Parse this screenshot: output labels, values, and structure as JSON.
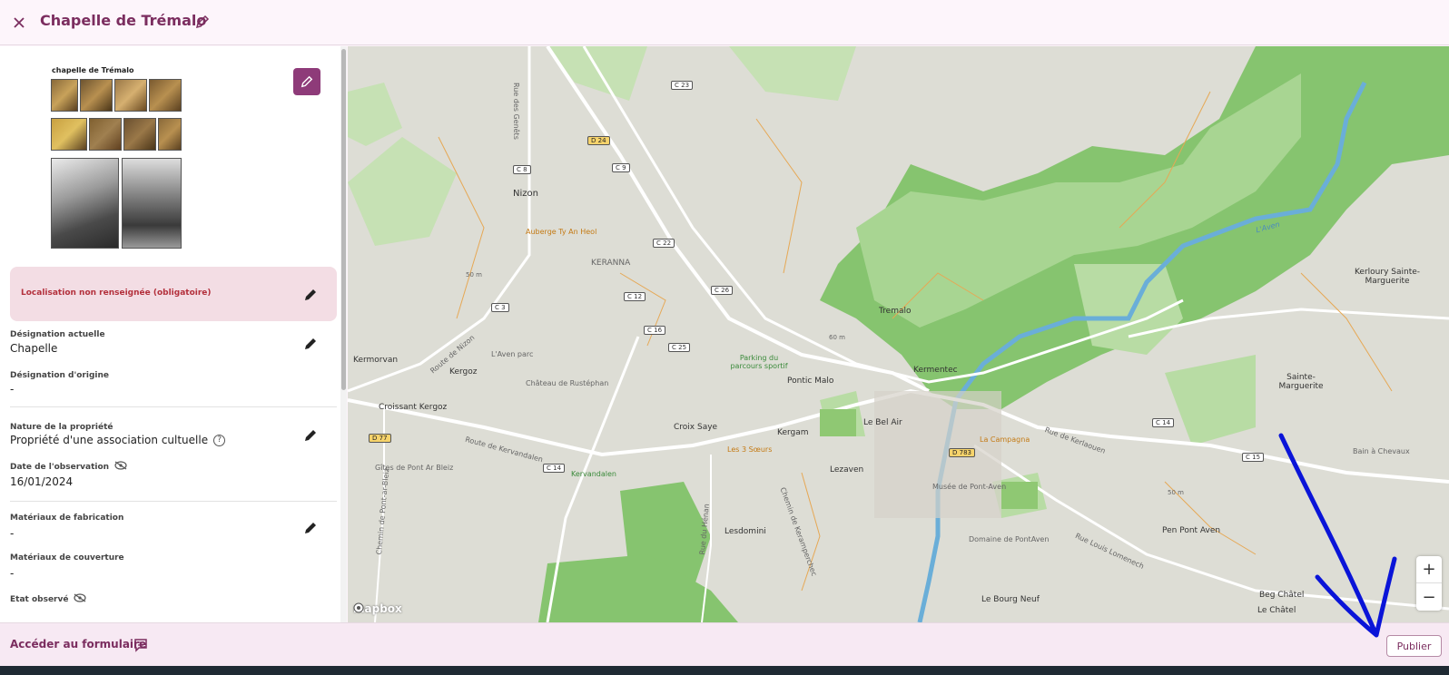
{
  "header": {
    "title": "Chapelle de Trémalo"
  },
  "photo": {
    "caption": "chapelle de Trémalo"
  },
  "alert": {
    "text": "Localisation non renseignée (obligatoire)"
  },
  "fields": {
    "designation_actuelle_label": "Désignation actuelle",
    "designation_actuelle_value": "Chapelle",
    "designation_origine_label": "Désignation d'origine",
    "designation_origine_value": "-",
    "nature_propriete_label": "Nature de la propriété",
    "nature_propriete_value": "Propriété d'une association cultuelle",
    "date_observation_label": "Date de l'observation",
    "date_observation_value": "16/01/2024",
    "materiaux_fabrication_label": "Matériaux de fabrication",
    "materiaux_fabrication_value": "-",
    "materiaux_couverture_label": "Matériaux de couverture",
    "materiaux_couverture_value": "-",
    "etat_observe_label": "Etat observé"
  },
  "map": {
    "attribution": "mapbox",
    "zoom_in": "+",
    "zoom_out": "−",
    "places": [
      "Nizon",
      "KERANNA",
      "Kermorvan",
      "Kergoz",
      "Croissant Kergoz",
      "Tremalo",
      "Kermentec",
      "Pontic Malo",
      "Croix Saye",
      "Kergam",
      "Le Bel Air",
      "Lezaven",
      "Lesdomini",
      "Kerloury Sainte-Marguerite",
      "Sainte-Marguerite",
      "Pen Pont Aven",
      "Beg Châtel",
      "Le Châtel",
      "Le Bourg Neuf"
    ],
    "pois": [
      "Auberge Ty An Heol",
      "L'Aven parc",
      "Château de Rustéphan",
      "Parking du parcours sportif",
      "Les 3 Sœurs",
      "La Campagna",
      "Musée de Pont-Aven",
      "Domaine de PontAven",
      "Gîtes de Pont Ar Bleiz",
      "Kervandalen",
      "Bain à Chevaux"
    ],
    "streets": [
      "Rue des Genêts",
      "Route de Nizon",
      "Route de Kervandalen",
      "Chemin de Keramperchec",
      "Rue du Hénan",
      "Rue Louis Lomenech",
      "Rue de Kerlaouen",
      "Chemin de Pont-ar-Bleiz",
      "L'Aven"
    ],
    "roads": [
      "C 23",
      "D 24",
      "C 8",
      "C 9",
      "C 22",
      "C 3",
      "C 12",
      "C 26",
      "C 16",
      "C 25",
      "D 77",
      "C 14",
      "D 783",
      "C 15"
    ],
    "contours": [
      "50 m",
      "60 m",
      "50 m"
    ]
  },
  "footer": {
    "form_link": "Accéder au formulaire",
    "publish_label": "Publier"
  }
}
